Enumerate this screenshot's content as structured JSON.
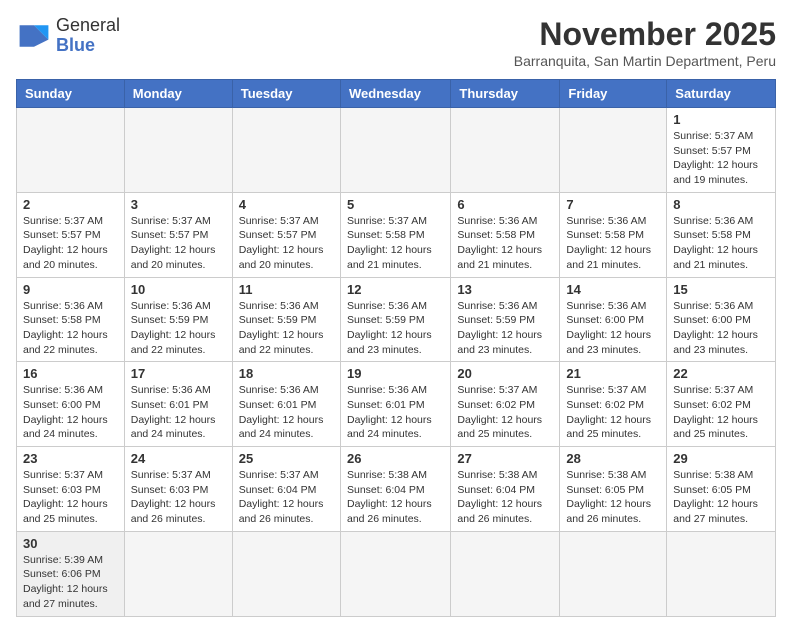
{
  "header": {
    "logo_line1": "General",
    "logo_line2": "Blue",
    "month_title": "November 2025",
    "subtitle": "Barranquita, San Martin Department, Peru"
  },
  "days_of_week": [
    "Sunday",
    "Monday",
    "Tuesday",
    "Wednesday",
    "Thursday",
    "Friday",
    "Saturday"
  ],
  "weeks": [
    [
      {
        "day": "",
        "info": ""
      },
      {
        "day": "",
        "info": ""
      },
      {
        "day": "",
        "info": ""
      },
      {
        "day": "",
        "info": ""
      },
      {
        "day": "",
        "info": ""
      },
      {
        "day": "",
        "info": ""
      },
      {
        "day": "1",
        "info": "Sunrise: 5:37 AM\nSunset: 5:57 PM\nDaylight: 12 hours and 19 minutes."
      }
    ],
    [
      {
        "day": "2",
        "info": "Sunrise: 5:37 AM\nSunset: 5:57 PM\nDaylight: 12 hours and 20 minutes."
      },
      {
        "day": "3",
        "info": "Sunrise: 5:37 AM\nSunset: 5:57 PM\nDaylight: 12 hours and 20 minutes."
      },
      {
        "day": "4",
        "info": "Sunrise: 5:37 AM\nSunset: 5:57 PM\nDaylight: 12 hours and 20 minutes."
      },
      {
        "day": "5",
        "info": "Sunrise: 5:37 AM\nSunset: 5:58 PM\nDaylight: 12 hours and 21 minutes."
      },
      {
        "day": "6",
        "info": "Sunrise: 5:36 AM\nSunset: 5:58 PM\nDaylight: 12 hours and 21 minutes."
      },
      {
        "day": "7",
        "info": "Sunrise: 5:36 AM\nSunset: 5:58 PM\nDaylight: 12 hours and 21 minutes."
      },
      {
        "day": "8",
        "info": "Sunrise: 5:36 AM\nSunset: 5:58 PM\nDaylight: 12 hours and 21 minutes."
      }
    ],
    [
      {
        "day": "9",
        "info": "Sunrise: 5:36 AM\nSunset: 5:58 PM\nDaylight: 12 hours and 22 minutes."
      },
      {
        "day": "10",
        "info": "Sunrise: 5:36 AM\nSunset: 5:59 PM\nDaylight: 12 hours and 22 minutes."
      },
      {
        "day": "11",
        "info": "Sunrise: 5:36 AM\nSunset: 5:59 PM\nDaylight: 12 hours and 22 minutes."
      },
      {
        "day": "12",
        "info": "Sunrise: 5:36 AM\nSunset: 5:59 PM\nDaylight: 12 hours and 23 minutes."
      },
      {
        "day": "13",
        "info": "Sunrise: 5:36 AM\nSunset: 5:59 PM\nDaylight: 12 hours and 23 minutes."
      },
      {
        "day": "14",
        "info": "Sunrise: 5:36 AM\nSunset: 6:00 PM\nDaylight: 12 hours and 23 minutes."
      },
      {
        "day": "15",
        "info": "Sunrise: 5:36 AM\nSunset: 6:00 PM\nDaylight: 12 hours and 23 minutes."
      }
    ],
    [
      {
        "day": "16",
        "info": "Sunrise: 5:36 AM\nSunset: 6:00 PM\nDaylight: 12 hours and 24 minutes."
      },
      {
        "day": "17",
        "info": "Sunrise: 5:36 AM\nSunset: 6:01 PM\nDaylight: 12 hours and 24 minutes."
      },
      {
        "day": "18",
        "info": "Sunrise: 5:36 AM\nSunset: 6:01 PM\nDaylight: 12 hours and 24 minutes."
      },
      {
        "day": "19",
        "info": "Sunrise: 5:36 AM\nSunset: 6:01 PM\nDaylight: 12 hours and 24 minutes."
      },
      {
        "day": "20",
        "info": "Sunrise: 5:37 AM\nSunset: 6:02 PM\nDaylight: 12 hours and 25 minutes."
      },
      {
        "day": "21",
        "info": "Sunrise: 5:37 AM\nSunset: 6:02 PM\nDaylight: 12 hours and 25 minutes."
      },
      {
        "day": "22",
        "info": "Sunrise: 5:37 AM\nSunset: 6:02 PM\nDaylight: 12 hours and 25 minutes."
      }
    ],
    [
      {
        "day": "23",
        "info": "Sunrise: 5:37 AM\nSunset: 6:03 PM\nDaylight: 12 hours and 25 minutes."
      },
      {
        "day": "24",
        "info": "Sunrise: 5:37 AM\nSunset: 6:03 PM\nDaylight: 12 hours and 26 minutes."
      },
      {
        "day": "25",
        "info": "Sunrise: 5:37 AM\nSunset: 6:04 PM\nDaylight: 12 hours and 26 minutes."
      },
      {
        "day": "26",
        "info": "Sunrise: 5:38 AM\nSunset: 6:04 PM\nDaylight: 12 hours and 26 minutes."
      },
      {
        "day": "27",
        "info": "Sunrise: 5:38 AM\nSunset: 6:04 PM\nDaylight: 12 hours and 26 minutes."
      },
      {
        "day": "28",
        "info": "Sunrise: 5:38 AM\nSunset: 6:05 PM\nDaylight: 12 hours and 26 minutes."
      },
      {
        "day": "29",
        "info": "Sunrise: 5:38 AM\nSunset: 6:05 PM\nDaylight: 12 hours and 27 minutes."
      }
    ],
    [
      {
        "day": "30",
        "info": "Sunrise: 5:39 AM\nSunset: 6:06 PM\nDaylight: 12 hours and 27 minutes."
      },
      {
        "day": "",
        "info": ""
      },
      {
        "day": "",
        "info": ""
      },
      {
        "day": "",
        "info": ""
      },
      {
        "day": "",
        "info": ""
      },
      {
        "day": "",
        "info": ""
      },
      {
        "day": "",
        "info": ""
      }
    ]
  ]
}
